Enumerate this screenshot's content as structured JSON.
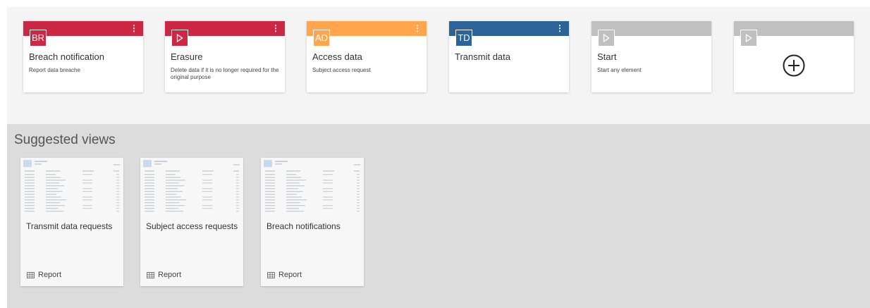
{
  "tiles": [
    {
      "badge": "BR",
      "badge_icon": "",
      "title": "Breach notification",
      "desc": "Report data breache",
      "color": "#cc2844",
      "menu": true,
      "add": false
    },
    {
      "badge": "",
      "badge_icon": "play-icon",
      "title": "Erasure",
      "desc": "Delete data if it is no longer required for the original purpose",
      "color": "#cc2844",
      "menu": true,
      "add": false
    },
    {
      "badge": "AD",
      "badge_icon": "",
      "title": "Access data",
      "desc": "Subject access request",
      "color": "#ffa64d",
      "menu": true,
      "add": false
    },
    {
      "badge": "TD",
      "badge_icon": "",
      "title": "Transmit data",
      "desc": "",
      "color": "#2e6399",
      "menu": true,
      "add": false
    },
    {
      "badge": "",
      "badge_icon": "play-icon",
      "title": "Start",
      "desc": "Start any element",
      "color": "#c0c0c0",
      "menu": false,
      "add": false
    },
    {
      "badge": "",
      "badge_icon": "play-icon",
      "title": "",
      "desc": "",
      "color": "#c0c0c0",
      "menu": false,
      "add": true,
      "add_icon": "plus-circle-icon"
    }
  ],
  "menu_glyph": "⋮",
  "suggested": {
    "heading": "Suggested views",
    "views": [
      {
        "title": "Transmit data requests",
        "type_label": "Report",
        "type_icon": "table-icon"
      },
      {
        "title": "Subject access requests",
        "type_label": "Report",
        "type_icon": "table-icon"
      },
      {
        "title": "Breach notifications",
        "type_label": "Report",
        "type_icon": "table-icon"
      }
    ]
  }
}
